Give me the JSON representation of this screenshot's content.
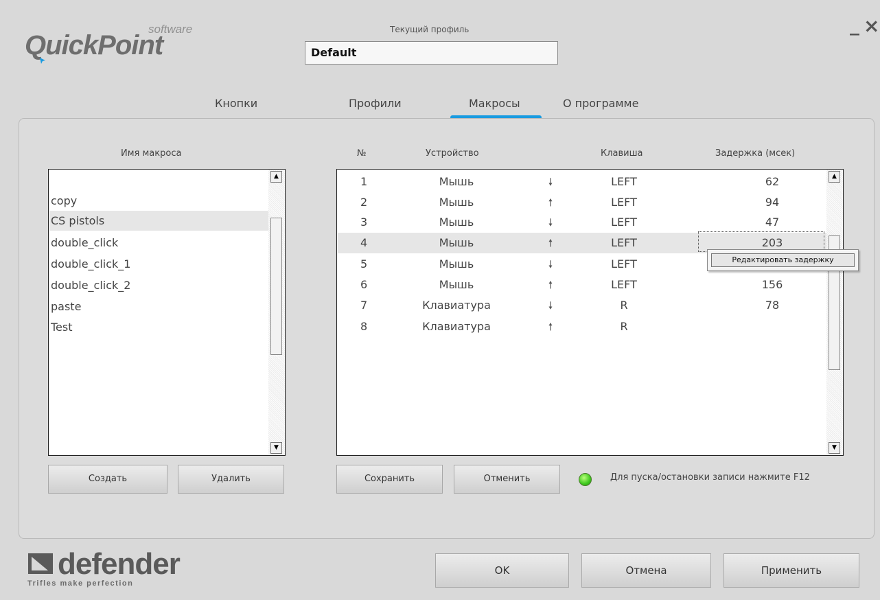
{
  "app": {
    "logo_main": "QuickPoint",
    "logo_sub": "software"
  },
  "profile": {
    "caption": "Текущий профиль",
    "value": "Default"
  },
  "window": {
    "minimize": "_",
    "close": "×"
  },
  "tabs": [
    {
      "label": "Кнопки"
    },
    {
      "label": "Профили"
    },
    {
      "label": "Макросы",
      "active": true
    },
    {
      "label": "О программе"
    }
  ],
  "macro_list": {
    "header": "Имя макроса",
    "items": [
      "copy",
      "CS pistols",
      "double_click",
      "double_click_1",
      "double_click_2",
      "paste",
      "Test"
    ],
    "selected": "CS pistols"
  },
  "steps": {
    "headers": {
      "num": "№",
      "device": "Устройство",
      "key": "Клавиша",
      "delay": "Задержка (мсек)"
    },
    "rows": [
      {
        "num": "1",
        "device": "Мышь",
        "dir": "down",
        "key": "LEFT",
        "delay": "62"
      },
      {
        "num": "2",
        "device": "Мышь",
        "dir": "up",
        "key": "LEFT",
        "delay": "94"
      },
      {
        "num": "3",
        "device": "Мышь",
        "dir": "down",
        "key": "LEFT",
        "delay": "47"
      },
      {
        "num": "4",
        "device": "Мышь",
        "dir": "up",
        "key": "LEFT",
        "delay": "203"
      },
      {
        "num": "5",
        "device": "Мышь",
        "dir": "down",
        "key": "LEFT",
        "delay": ""
      },
      {
        "num": "6",
        "device": "Мышь",
        "dir": "up",
        "key": "LEFT",
        "delay": "156"
      },
      {
        "num": "7",
        "device": "Клавиатура",
        "dir": "down",
        "key": "R",
        "delay": "78"
      },
      {
        "num": "8",
        "device": "Клавиатура",
        "dir": "up",
        "key": "R",
        "delay": ""
      }
    ],
    "selected_row": "4"
  },
  "context_menu": {
    "item": "Редактировать задержку"
  },
  "buttons": {
    "create": "Создать",
    "delete": "Удалить",
    "save": "Сохранить",
    "cancel": "Отменить",
    "ok": "OK",
    "dialog_cancel": "Отмена",
    "apply": "Применить"
  },
  "record": {
    "hint": "Для пуска/остановки записи нажмите F12",
    "led_color": "#3ec81e"
  },
  "brand": {
    "name": "defender",
    "tagline": "Trifles make perfection"
  },
  "icons": {
    "arrow_down": "🠗",
    "arrow_up": "🠕",
    "scroll_up": "▲",
    "scroll_down": "▼"
  }
}
